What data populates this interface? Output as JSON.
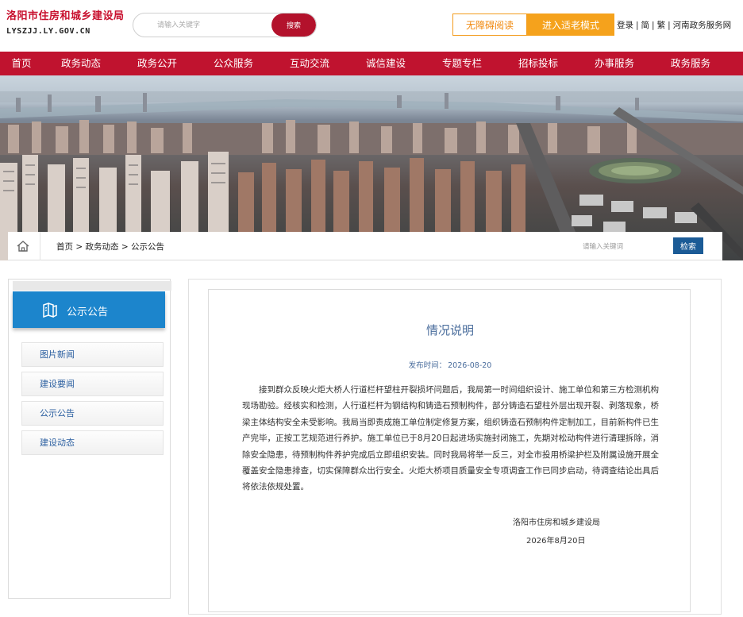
{
  "header": {
    "logo_cn": "洛阳市住房和城乡建设局",
    "logo_en": "LYSZJJ.LY.GOV.CN",
    "search_placeholder": "请输入关键字",
    "search_button": "搜索",
    "accessible_reading": "无障碍阅读",
    "elderly_mode": "进入适老模式",
    "login": "登录",
    "simplified": "简",
    "traditional": "繁",
    "henan_service": "河南政务服务网"
  },
  "nav": {
    "items": [
      "首页",
      "政务动态",
      "政务公开",
      "公众服务",
      "互动交流",
      "诚信建设",
      "专题专栏",
      "招标投标",
      "办事服务",
      "政务服务"
    ]
  },
  "breadcrumb": {
    "home": "首页",
    "sep": " > ",
    "level1": "政务动态",
    "level2": "公示公告",
    "search_placeholder": "请输入关键词",
    "search_button": "检索"
  },
  "sidebar": {
    "title": "公示公告",
    "items": [
      "图片新闻",
      "建设要闻",
      "公示公告",
      "建设动态"
    ]
  },
  "article": {
    "title": "情况说明",
    "date_label": "发布时间：",
    "date": "2026-08-20",
    "body": "接到群众反映火炬大桥人行道栏杆望柱开裂损坏问题后，我局第一时间组织设计、施工单位和第三方检测机构现场勘验。经核实和检测，人行道栏杆为钢结构和铸造石预制构件，部分铸造石望柱外层出现开裂、剥落现象，桥梁主体结构安全未受影响。我局当即责成施工单位制定修复方案，组织铸造石预制构件定制加工，目前新构件已生产完毕，正按工艺规范进行养护。施工单位已于8月20日起进场实施封闭施工，先期对松动构件进行清理拆除，消除安全隐患，待预制构件养护完成后立即组织安装。同时我局将举一反三，对全市投用桥梁护栏及附属设施开展全覆盖安全隐患排查，切实保障群众出行安全。火炬大桥项目质量安全专项调查工作已同步启动，待调查结论出具后将依法依规处置。",
    "signature": "洛阳市住房和城乡建设局",
    "sign_date": "2026年8月20日"
  },
  "colors": {
    "nav_red": "#c0132f",
    "sidebar_blue": "#1c85cc",
    "accessible_orange": "#f39b1c",
    "elderly_orange": "#f5a21c",
    "search_red": "#b3122c",
    "link_blue": "#2b5fa0"
  },
  "icons": {
    "breadcrumb_home": "home-icon",
    "sidebar_header": "book-icon"
  }
}
